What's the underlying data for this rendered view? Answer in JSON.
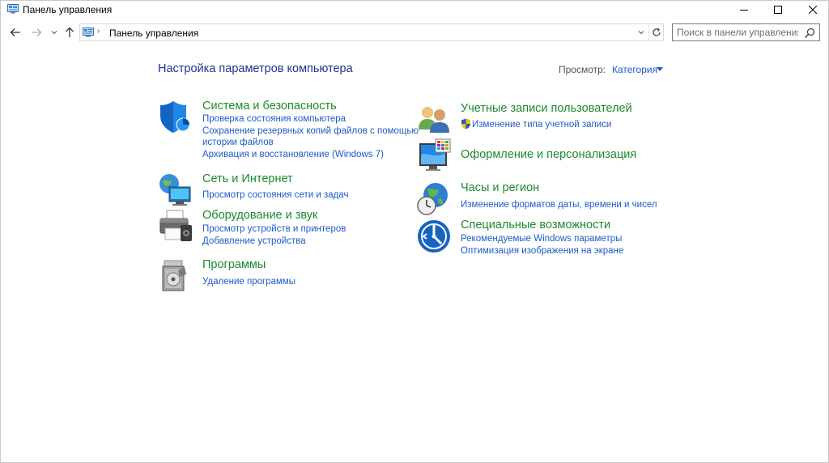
{
  "window": {
    "title": "Панель управления"
  },
  "address": {
    "path": "Панель управления",
    "separator": "›"
  },
  "search": {
    "placeholder": "Поиск в панели управления"
  },
  "content": {
    "heading": "Настройка параметров компьютера",
    "view_label": "Просмотр:",
    "view_value": "Категория"
  },
  "categories": {
    "system": {
      "title": "Система и безопасность",
      "links": [
        "Проверка состояния компьютера",
        "Сохранение резервных копий файлов с помощью",
        "истории файлов",
        "Архивация и восстановление (Windows 7)"
      ]
    },
    "network": {
      "title": "Сеть и Интернет",
      "links": [
        "Просмотр состояния сети и задач"
      ]
    },
    "hardware": {
      "title": "Оборудование и звук",
      "links": [
        "Просмотр устройств и принтеров",
        "Добавление устройства"
      ]
    },
    "programs": {
      "title": "Программы",
      "links": [
        "Удаление программы"
      ]
    },
    "accounts": {
      "title": "Учетные записи пользователей",
      "links": [
        "Изменение типа учетной записи"
      ]
    },
    "appearance": {
      "title": "Оформление и персонализация",
      "links": []
    },
    "clock": {
      "title": "Часы и регион",
      "links": [
        "Изменение форматов даты, времени и чисел"
      ]
    },
    "ease": {
      "title": "Специальные возможности",
      "links": [
        "Рекомендуемые Windows параметры",
        "Оптимизация изображения на экране"
      ]
    }
  },
  "colors": {
    "heading": "#1e3287",
    "category_title": "#1c8a2e",
    "link": "#1e5bc6"
  },
  "icons": {
    "title": "control-panel-icon",
    "back": "arrow-left-icon",
    "forward": "arrow-right-icon",
    "recent": "chevron-down-icon",
    "up": "arrow-up-icon",
    "refresh": "refresh-icon",
    "search": "search-icon"
  }
}
